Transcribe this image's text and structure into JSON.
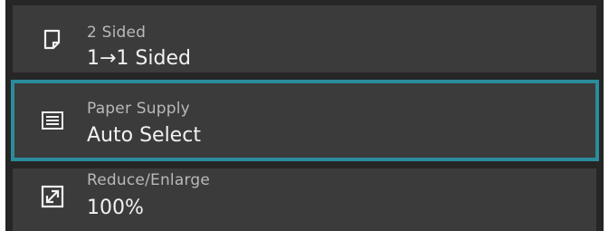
{
  "settings": [
    {
      "label": "2 Sided",
      "value": "1→1 Sided",
      "icon": "document-page-icon"
    },
    {
      "label": "Paper Supply",
      "value": "Auto Select",
      "icon": "paper-tray-icon"
    },
    {
      "label": "Reduce/Enlarge",
      "value": "100%",
      "icon": "enlarge-icon"
    }
  ],
  "colors": {
    "panel_background": "#262626",
    "row_background": "#3b3b3b",
    "selected_border": "#2a8c9c",
    "label_text": "#b9b9b9",
    "value_text": "#f2f2f2"
  }
}
